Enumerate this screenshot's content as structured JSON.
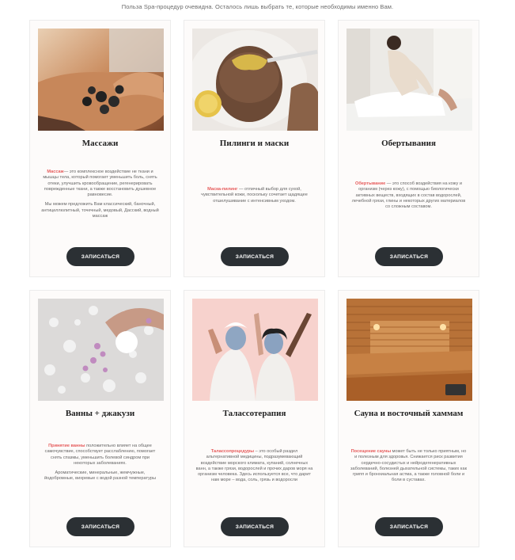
{
  "intro": "Польза Spa-процедур очевидна. Осталось лишь выбрать те, которые необходимы именно Вам.",
  "button_label": "ЗАПИСАТЬСЯ",
  "colors": {
    "accent": "#e65b5b",
    "button": "#2b3034",
    "card_bg": "#fdfbfa"
  },
  "cards": [
    {
      "title": "Массажи",
      "highlight": "Массаж",
      "text": "— это комплексное воздействие не ткани и мышцы тела, который помогает уменьшить боль, снять отеки, улучшить кровообращение, регенерировать поврежденные ткани, а также восстановить душевное равновесие.",
      "text2": "Мы можем предложить Вам классический, баночный, антицеллюлитный, точечный, медовый, Дасский, водный массаж"
    },
    {
      "title": "Пилинги и маски",
      "highlight": "Маска-пилинг",
      "text": " — отличный выбор для сухой, чувствительной кожи, поскольку сочетает щадящее отшелушивание с интенсивным уходом."
    },
    {
      "title": "Обертывания",
      "highlight": "Обертывание",
      "text": " — это способ воздействия на кожу и организм (через кожу), с помощью биологически активных веществ, входящих в состав водорослей, лечебной грязи, глины и некоторых других материалов со сложным составом."
    },
    {
      "title": "Ванны + джакузи",
      "highlight": "Принятие ванны",
      "text": " положительно влияет на общее самочувствие, способствует расслаблению, помогает снять спазмы, уменьшить болевой синдром при некоторых заболеваниях.",
      "text2": "Ароматические, минеральные, жемчужные, йодобромные, вихревые с водой разной температуры"
    },
    {
      "title": "Талассотерапия",
      "highlight": "Талассопроцедуры",
      "text": " – это особый раздел альтернативной медицины, подразумевающий воздействие морского климата, купаний, солнечных ванн, а также грязи, водорослей и прочих даров моря на организм человека. Здесь используется все, что дарит нам море – вода, соль, грязь и водоросли"
    },
    {
      "title": "Сауна и восточный хаммам",
      "highlight": "Посещение сауны",
      "text": " может быть не только приятным, но и полезным для здоровья. Снижается риск развития сердечно-сосудистых и нейродегенеративных заболеваний, болезней дыхательной системы, таких как грипп и бронхиальная астма, а также головной боли и боли в суставах."
    }
  ]
}
